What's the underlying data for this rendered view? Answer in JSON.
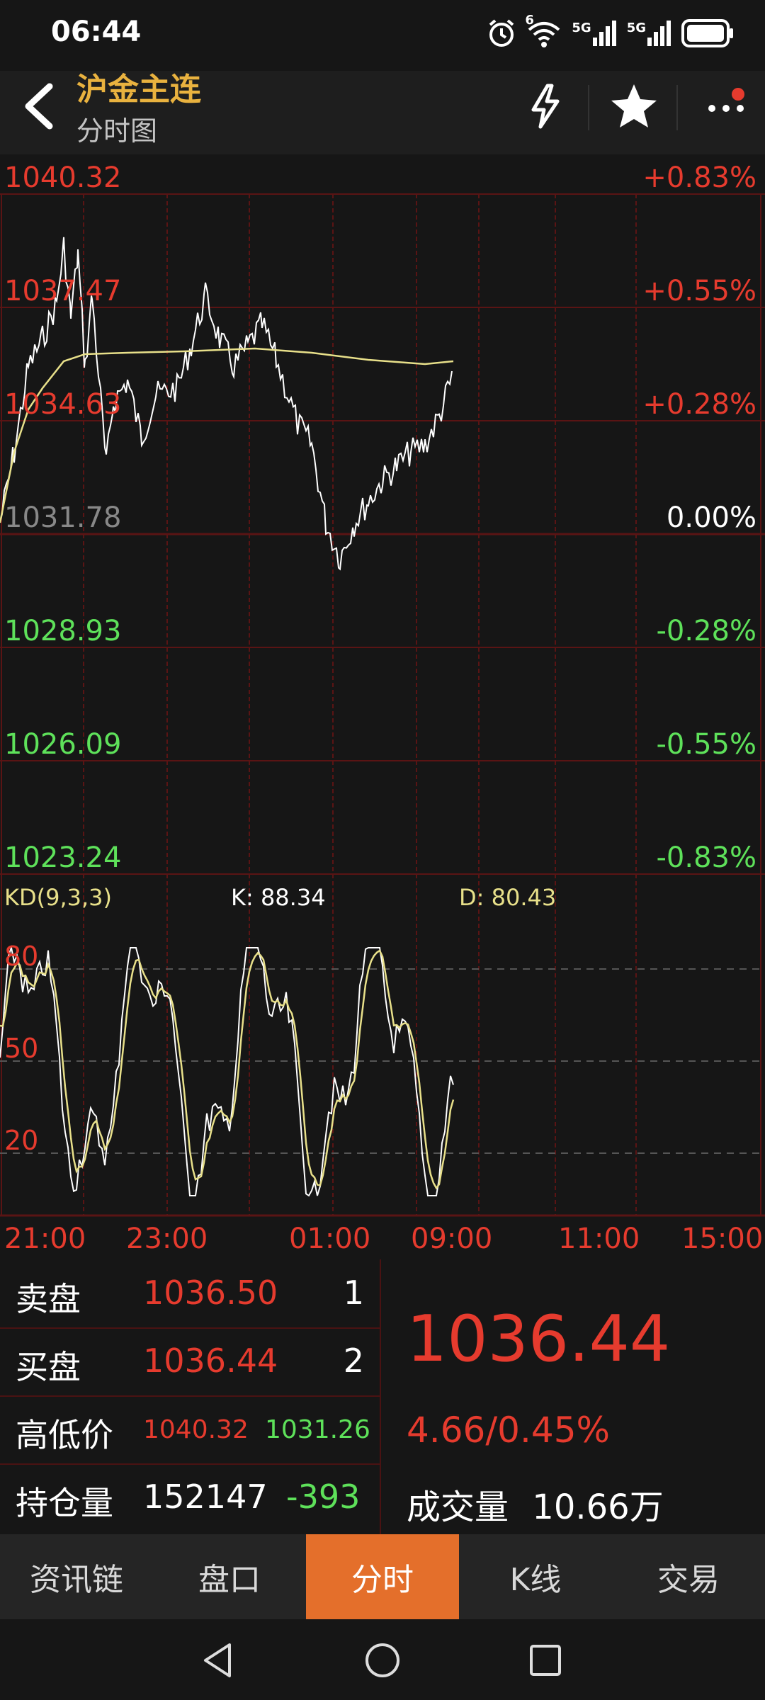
{
  "status_bar": {
    "time": "06:44",
    "signal_1": "5G",
    "signal_2": "5G",
    "wifi_badge": "6"
  },
  "header": {
    "title": "沪金主连",
    "subtitle": "分时图"
  },
  "chart": {
    "price_labels": [
      "1040.32",
      "1037.47",
      "1034.63",
      "1031.78",
      "1028.93",
      "1026.09",
      "1023.24"
    ],
    "pct_labels": [
      "+0.83%",
      "+0.55%",
      "+0.28%",
      "0.00%",
      "-0.28%",
      "-0.55%",
      "-0.83%"
    ],
    "kd_title": "KD(9,3,3)",
    "k_label": "K: 88.34",
    "d_label": "D: 80.43",
    "kd_levels": [
      "80",
      "50",
      "20"
    ],
    "time_labels": [
      "21:00",
      "23:00",
      "01:00",
      "09:00",
      "11:00",
      "15:00"
    ],
    "colors": {
      "up": "#e63b2e",
      "down": "#5ee15a",
      "flat": "#888888",
      "price_line": "#ffffff",
      "avg_line": "#e8e08a",
      "grid": "#5a1414"
    }
  },
  "chart_data": {
    "type": "line",
    "title": "",
    "x": [
      "21:00",
      "23:00",
      "01:00",
      "09:00"
    ],
    "ylim": [
      1023.24,
      1040.32
    ],
    "series": [],
    "kd": {
      "K": 88.34,
      "D": 80.43
    }
  },
  "info": {
    "sell_label": "卖盘",
    "sell_price": "1036.50",
    "sell_qty": "1",
    "buy_label": "买盘",
    "buy_price": "1036.44",
    "buy_qty": "2",
    "hl_label": "高低价",
    "high": "1040.32",
    "low": "1031.26",
    "oi_label": "持仓量",
    "oi_value": "152147",
    "oi_change": "-393",
    "last_price": "1036.44",
    "change": "4.66/0.45%",
    "volume_label": "成交量",
    "volume_value": "10.66万"
  },
  "tabs": [
    "资讯链",
    "盘口",
    "分时",
    "K线",
    "交易"
  ],
  "active_tab": "分时"
}
